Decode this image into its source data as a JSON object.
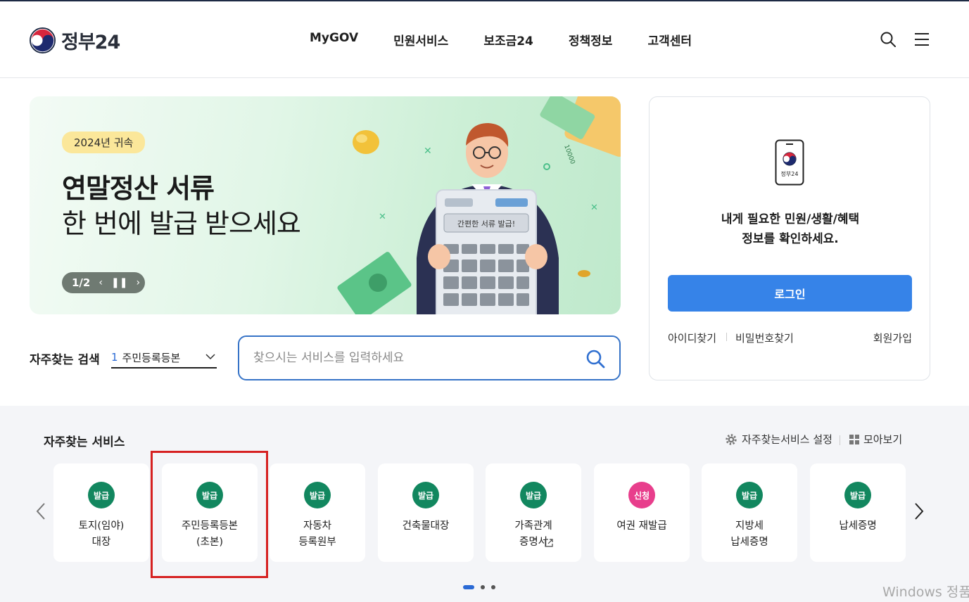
{
  "header": {
    "logo_text": "정부24",
    "nav": [
      "MyGOV",
      "민원서비스",
      "보조금24",
      "정책정보",
      "고객센터"
    ],
    "icons": [
      "search-icon",
      "hamburger-menu-icon"
    ]
  },
  "banner": {
    "badge": "2024년 귀속",
    "title_line1": "연말정산 서류",
    "title_line2": "한 번에 발급 받으세요",
    "pager": "1/2",
    "calc_screen": "간편한 서류 발급!",
    "bill_text": "10000"
  },
  "search": {
    "label": "자주찾는 검색",
    "rank": "1",
    "keyword": "주민등록등본",
    "placeholder": "찾으시는 서비스를 입력하세요"
  },
  "login": {
    "phone_label": "정부24",
    "message_line1": "내게 필요한 민원/생활/혜택",
    "message_line2": "정보를 확인하세요.",
    "button": "로그인",
    "find_id": "아이디찾기",
    "find_pw": "비밀번호찾기",
    "join": "회원가입"
  },
  "services": {
    "title": "자주찾는 서비스",
    "settings": "자주찾는서비스 설정",
    "view_all": "모아보기",
    "cards": [
      {
        "tag": "발급",
        "tag_color": "#12875f",
        "label": "토지(임야)\n대장"
      },
      {
        "tag": "발급",
        "tag_color": "#12875f",
        "label": "주민등록등본\n(초본)"
      },
      {
        "tag": "발급",
        "tag_color": "#12875f",
        "label": "자동차\n등록원부"
      },
      {
        "tag": "발급",
        "tag_color": "#12875f",
        "label": "건축물대장"
      },
      {
        "tag": "발급",
        "tag_color": "#12875f",
        "label": "가족관계\n증명서"
      },
      {
        "tag": "신청",
        "tag_color": "#e83e8c",
        "label": "여권 재발급"
      },
      {
        "tag": "발급",
        "tag_color": "#12875f",
        "label": "지방세\n납세증명"
      },
      {
        "tag": "발급",
        "tag_color": "#12875f",
        "label": "납세증명"
      }
    ],
    "page_count": 3,
    "active_page": 1
  },
  "watermark": "Windows 정품",
  "colors": {
    "accent": "#3683e8",
    "search_border": "#3673c7",
    "issue_tag": "#12875f",
    "apply_tag": "#e83e8c",
    "highlight": "#d62121"
  }
}
